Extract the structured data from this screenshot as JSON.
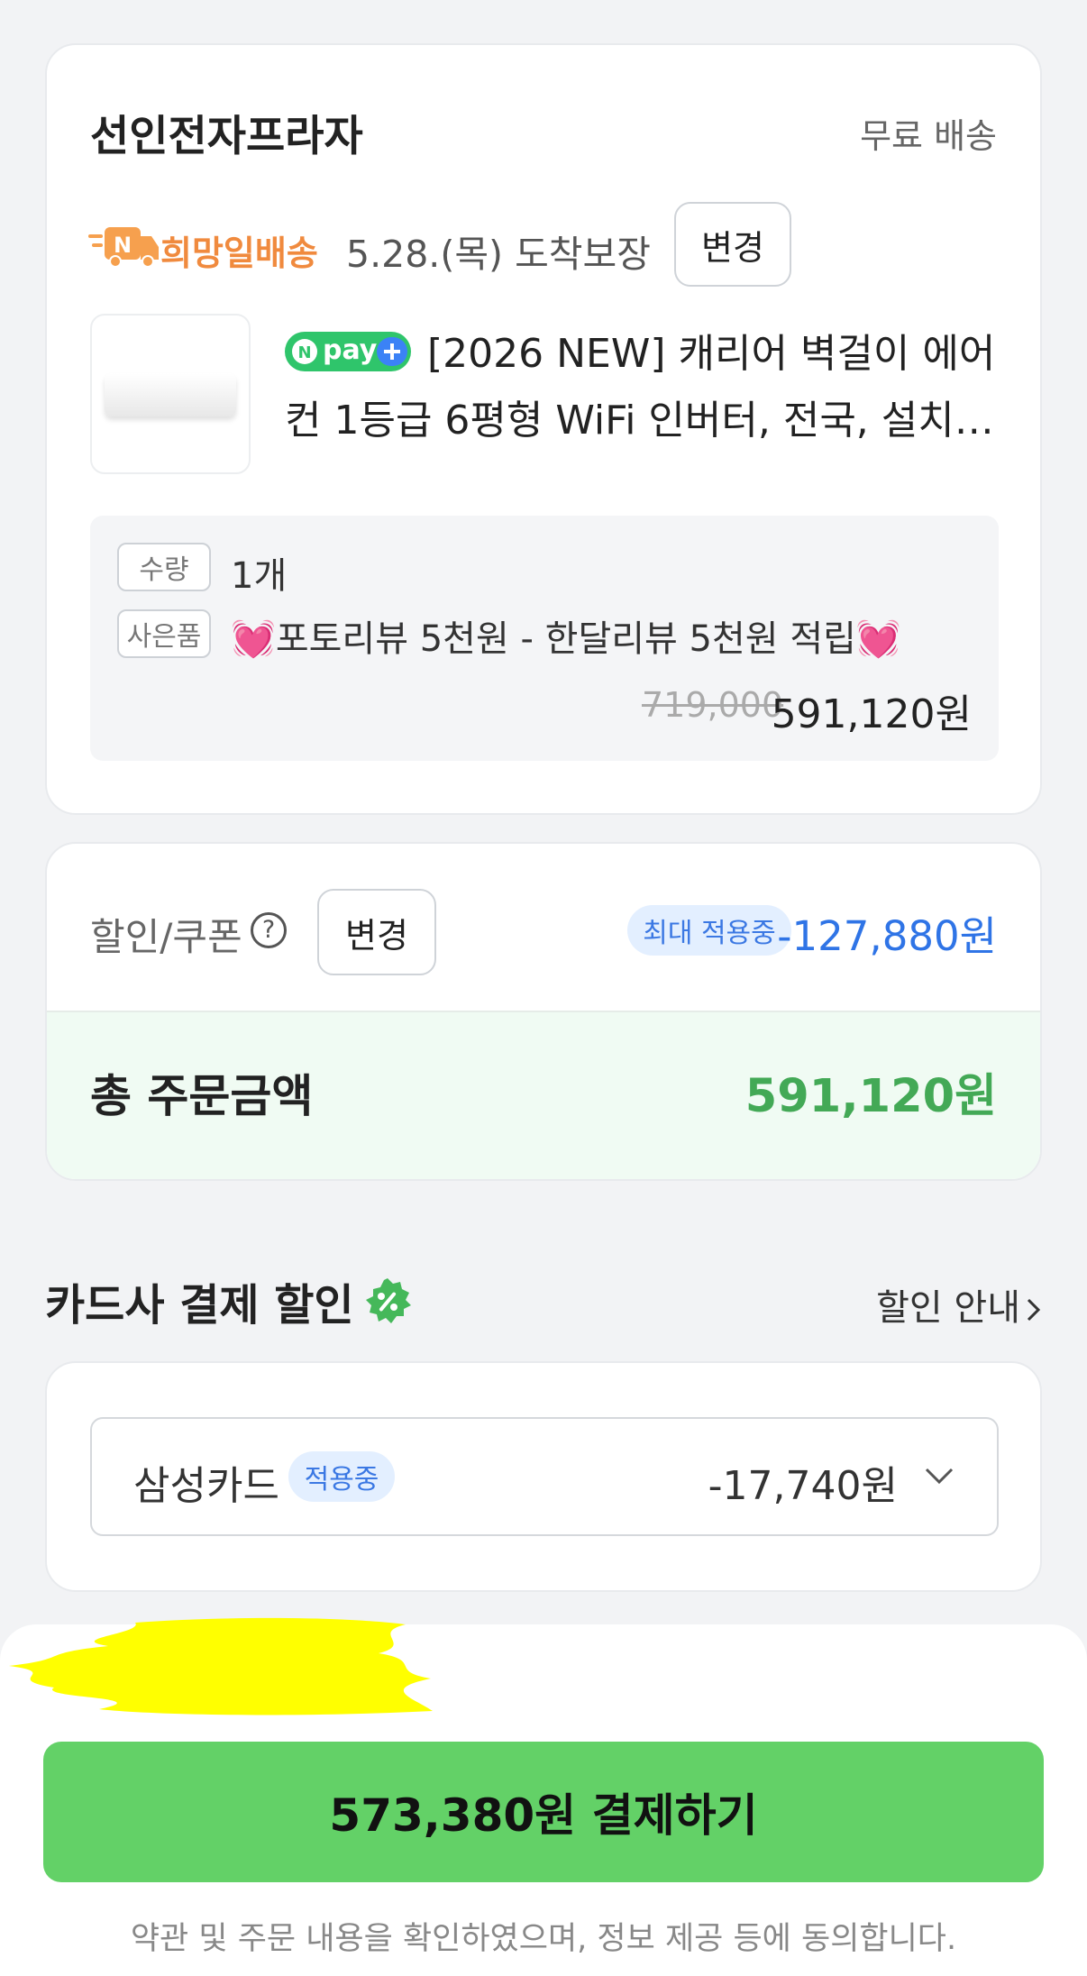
{
  "store": {
    "name": "선인전자프라자",
    "shipping": "무료 배송"
  },
  "delivery": {
    "label": "희망일배송",
    "arrival": "5.28.(목) 도착보장",
    "change_label": "변경"
  },
  "product": {
    "badge": "pay",
    "title_line1": "[2026 NEW] 캐리어 벽걸이 에어",
    "title_line2": "컨 1등급 6평형 WiFi 인버터, 전국, 설치…",
    "quantity_tag": "수량",
    "quantity": "1개",
    "gift_tag": "사은품",
    "gift_heart": "💓",
    "gift_text": "포토리뷰 5천원 - 한달리뷰 5천원 적립",
    "original_price": "719,000",
    "price": "591,120원"
  },
  "discount": {
    "label": "할인/쿠폰",
    "help_icon": "?",
    "change_label": "변경",
    "badge": "최대 적용중",
    "amount": "-127,880원",
    "total_label": "총 주문금액",
    "total_amount": "591,120원"
  },
  "card_section": {
    "title": "카드사 결제 할인",
    "guide": "할인 안내",
    "card_name": "삼성카드",
    "applied_badge": "적용중",
    "card_amount": "-17,740원"
  },
  "footer": {
    "pay_button": "573,380원 결제하기",
    "agreement": "약관 및 주문 내용을 확인하였으며, 정보 제공 등에 동의합니다."
  },
  "colors": {
    "accent_green": "#63d167",
    "total_green": "#43a956",
    "discount_blue": "#2f74e6",
    "hope_orange": "#f08a3e",
    "redaction_yellow": "#ffff00"
  }
}
